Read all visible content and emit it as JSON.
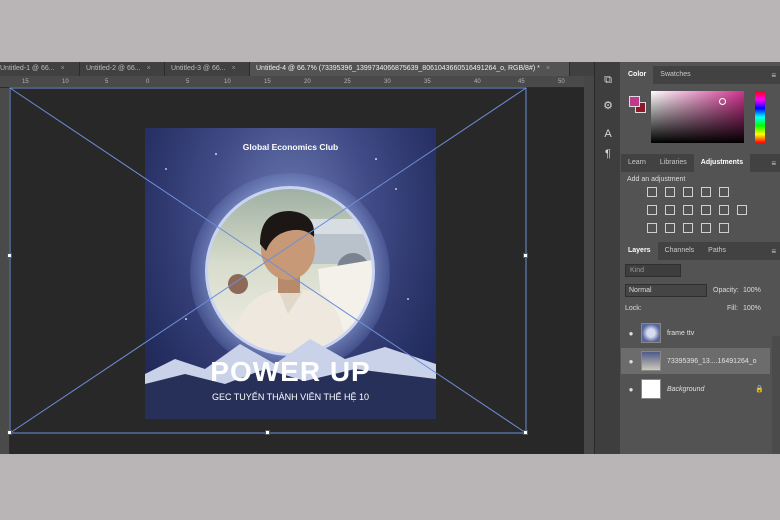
{
  "tabs": [
    {
      "label": "Untitled-1 @ 66...",
      "close": "×"
    },
    {
      "label": "Untitled-2 @ 66...",
      "close": "×"
    },
    {
      "label": "Untitled-3 @ 66...",
      "close": "×"
    },
    {
      "label": "Untitled-4 @ 66.7% (73395396_1399734066875639_8061043660516491264_o, RGB/8#) *",
      "close": "×"
    }
  ],
  "ruler_ticks": [
    "15",
    "10",
    "5",
    "0",
    "5",
    "10",
    "15",
    "20",
    "25",
    "30",
    "35",
    "40",
    "45",
    "50"
  ],
  "document": {
    "club_title": "Global Economics Club",
    "headline": "POWER UP",
    "subline": "GEC TUYỂN THÀNH VIÊN THẾ HỆ 10"
  },
  "color_panel": {
    "tabs": [
      "Color",
      "Swatches"
    ],
    "foreground": "#c0398a",
    "background": "#8c1a2c"
  },
  "adjustments_panel": {
    "tabs": [
      "Learn",
      "Libraries",
      "Adjustments"
    ],
    "add_label": "Add an adjustment"
  },
  "layers_panel": {
    "tabs": [
      "Layers",
      "Channels",
      "Paths"
    ],
    "kind_placeholder": "Kind",
    "blend_mode": "Normal",
    "opacity_label": "Opacity:",
    "opacity_value": "100%",
    "lock_label": "Lock:",
    "fill_label": "Fill:",
    "fill_value": "100%",
    "layers": [
      {
        "name": "frame ttv",
        "italic": false
      },
      {
        "name": "73395396_13....16491264_o",
        "italic": false
      },
      {
        "name": "Background",
        "italic": true
      }
    ]
  }
}
